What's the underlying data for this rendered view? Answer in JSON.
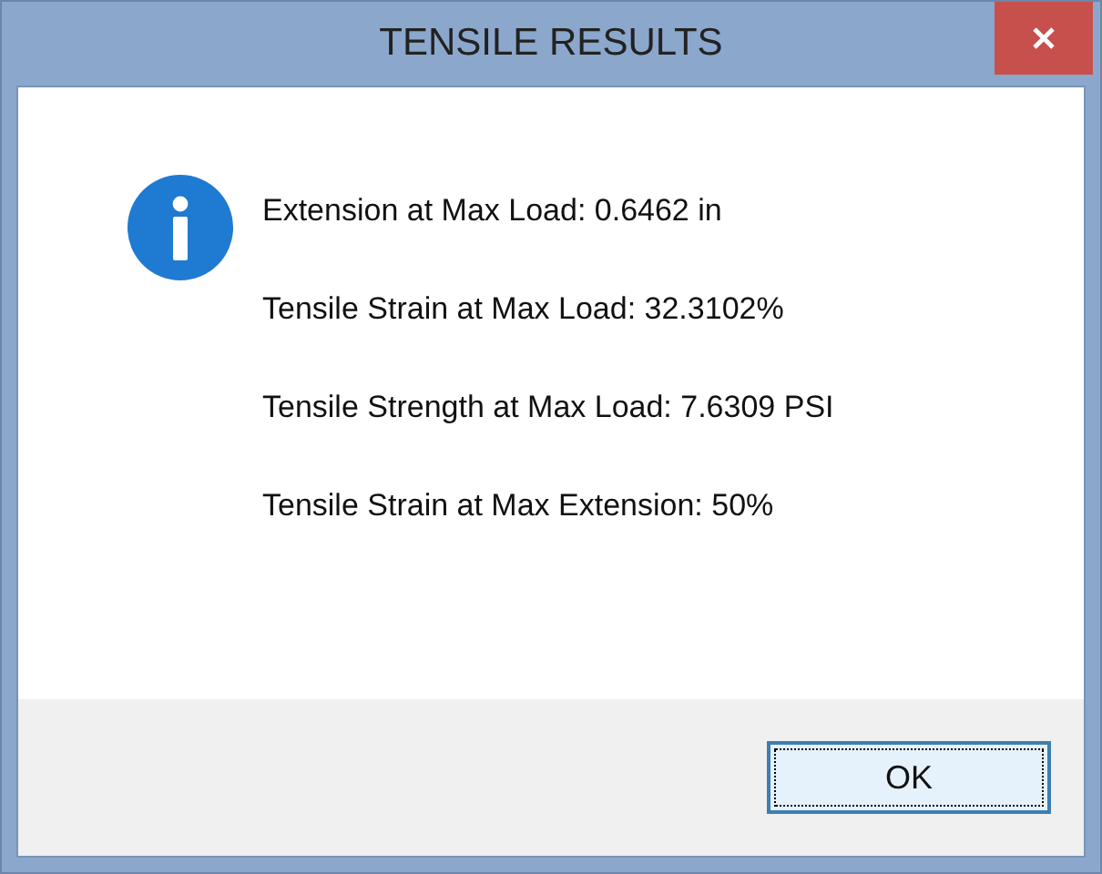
{
  "window": {
    "title": "TENSILE RESULTS"
  },
  "messages": [
    "Extension at Max Load: 0.6462 in",
    "Tensile Strain at Max Load: 32.3102%",
    "Tensile Strength at Max Load: 7.6309 PSI",
    "Tensile Strain at Max Extension: 50%"
  ],
  "buttons": [
    "OK"
  ]
}
